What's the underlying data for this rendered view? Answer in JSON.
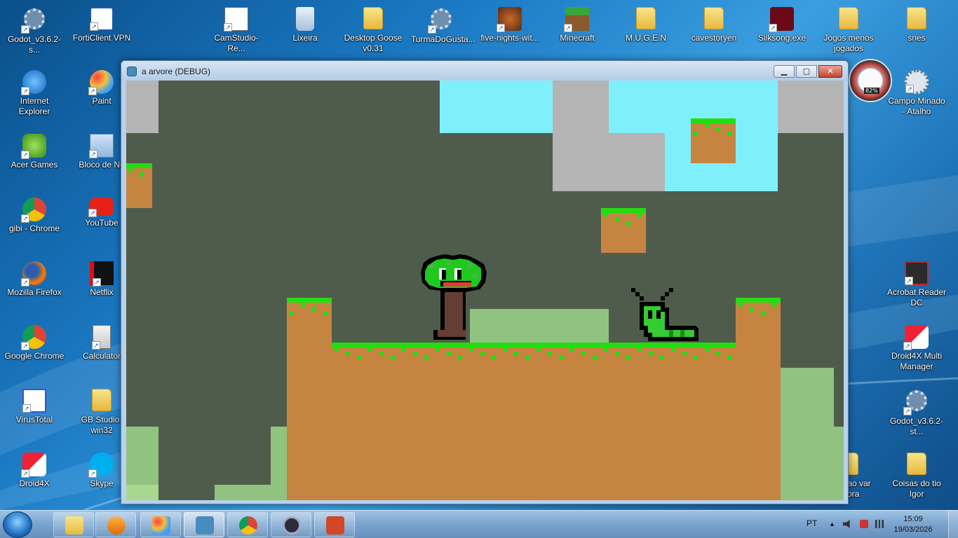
{
  "desktop": {
    "icons": [
      {
        "label": "Godot_v3.6.2-s...",
        "icon": "godot-icon"
      },
      {
        "label": "FortiClient VPN",
        "icon": "forticlient-icon"
      },
      {
        "label": "CamStudio-Re...",
        "icon": "camstudio-icon"
      },
      {
        "label": "Lixeira",
        "icon": "recycle-bin-icon"
      },
      {
        "label": "Desktop Goose v0.31",
        "icon": "folder-icon"
      },
      {
        "label": "TurmaDoGusta...",
        "icon": "godot-icon"
      },
      {
        "label": "five-nights-wit...",
        "icon": "fnaf-icon"
      },
      {
        "label": "Minecraft",
        "icon": "minecraft-icon"
      },
      {
        "label": "M.U.G.E.N",
        "icon": "folder-icon"
      },
      {
        "label": "cavestoryen",
        "icon": "folder-icon"
      },
      {
        "label": "Silksong.exe",
        "icon": "silksong-icon"
      },
      {
        "label": "Jogos menos jogados",
        "icon": "folder-icon"
      },
      {
        "label": "snes",
        "icon": "folder-icon"
      },
      {
        "label": "Internet Explorer",
        "icon": "internet-explorer-icon"
      },
      {
        "label": "Paint",
        "icon": "paint-icon"
      },
      {
        "label": "Campo Minado - Atalho",
        "icon": "minesweeper-icon"
      },
      {
        "label": "Acer Games",
        "icon": "acer-games-icon"
      },
      {
        "label": "Bloco de No",
        "icon": "notepad-icon"
      },
      {
        "label": "gibi - Chrome",
        "icon": "chrome-icon"
      },
      {
        "label": "YouTube",
        "icon": "youtube-icon"
      },
      {
        "label": "Mozilla Firefox",
        "icon": "firefox-icon"
      },
      {
        "label": "Netflix",
        "icon": "netflix-icon"
      },
      {
        "label": "Acrobat Reader DC",
        "icon": "acrobat-icon"
      },
      {
        "label": "Google Chrome",
        "icon": "chrome-icon"
      },
      {
        "label": "Calculator",
        "icon": "calculator-icon"
      },
      {
        "label": "Droid4X Multi Manager",
        "icon": "droid4x-icon"
      },
      {
        "label": "VirusTotal",
        "icon": "virustotal-icon"
      },
      {
        "label": "GB Studio-win32",
        "icon": "folder-icon"
      },
      {
        "label": "Godot_v3.6.2-st...",
        "icon": "godot-icon"
      },
      {
        "label": "Droid4X",
        "icon": "droid4x-icon"
      },
      {
        "label": "Skype",
        "icon": "skype-icon"
      },
      {
        "label": "que nao var agora",
        "icon": "folder-icon"
      },
      {
        "label": "Coisas do tio Igor",
        "icon": "folder-icon"
      }
    ],
    "gadget_text": "82%"
  },
  "window": {
    "title": "a arvore (DEBUG)",
    "minimize": "▁",
    "maximize": "▢",
    "close": "✕"
  },
  "game": {
    "colors": {
      "background": "#4f5c4b",
      "sky": "#7ff0fb",
      "stone": "#b4b4b4",
      "dirt": "#c58541",
      "grass": "#22dd11",
      "light_grass": "#90c380",
      "tree_leaf": "#1fca1f",
      "tree_trunk": "#653e33",
      "caterpillar": "#33cc33"
    },
    "characters": [
      "tree-character",
      "caterpillar-enemy"
    ]
  },
  "taskbar": {
    "apps": [
      "explorer-icon",
      "media-player-icon",
      "paint-icon",
      "godot-icon",
      "chrome-icon",
      "obs-icon",
      "powerpoint-icon"
    ],
    "active_app": "godot-icon",
    "language": "PT",
    "time": "15:09",
    "date": "19/03/2026"
  }
}
